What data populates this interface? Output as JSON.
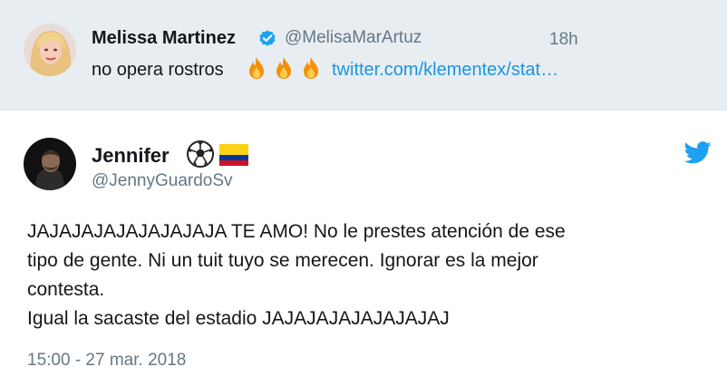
{
  "quoted_tweet": {
    "author_name": "Melissa Martinez",
    "handle": "@MelisaMarArtuz",
    "time": "18h",
    "text": "no opera rostros",
    "link": "twitter.com/klementex/stat…",
    "verified": true,
    "emoji": [
      "fire-icon",
      "fire-icon",
      "fire-icon"
    ]
  },
  "tweet": {
    "author_name": "Jennifer",
    "name_emoji": [
      "soccer-ball-icon",
      "colombia-flag-icon"
    ],
    "handle": "@JennyGuardoSv",
    "lines": [
      "JAJAJAJAJAJAJAJAJA TE AMO! No le prestes atención de ese",
      "tipo de gente. Ni un tuit tuyo se merecen. Ignorar es la mejor",
      "contesta.",
      "Igual la sacaste del estadio JAJAJAJAJAJAJAJAJ"
    ],
    "timestamp": "15:00 - 27 mar. 2018"
  },
  "colors": {
    "link_blue": "#1b95e0",
    "muted_gray": "#657786",
    "top_background": "#e8edf1",
    "twitter_blue": "#1da1f2"
  }
}
